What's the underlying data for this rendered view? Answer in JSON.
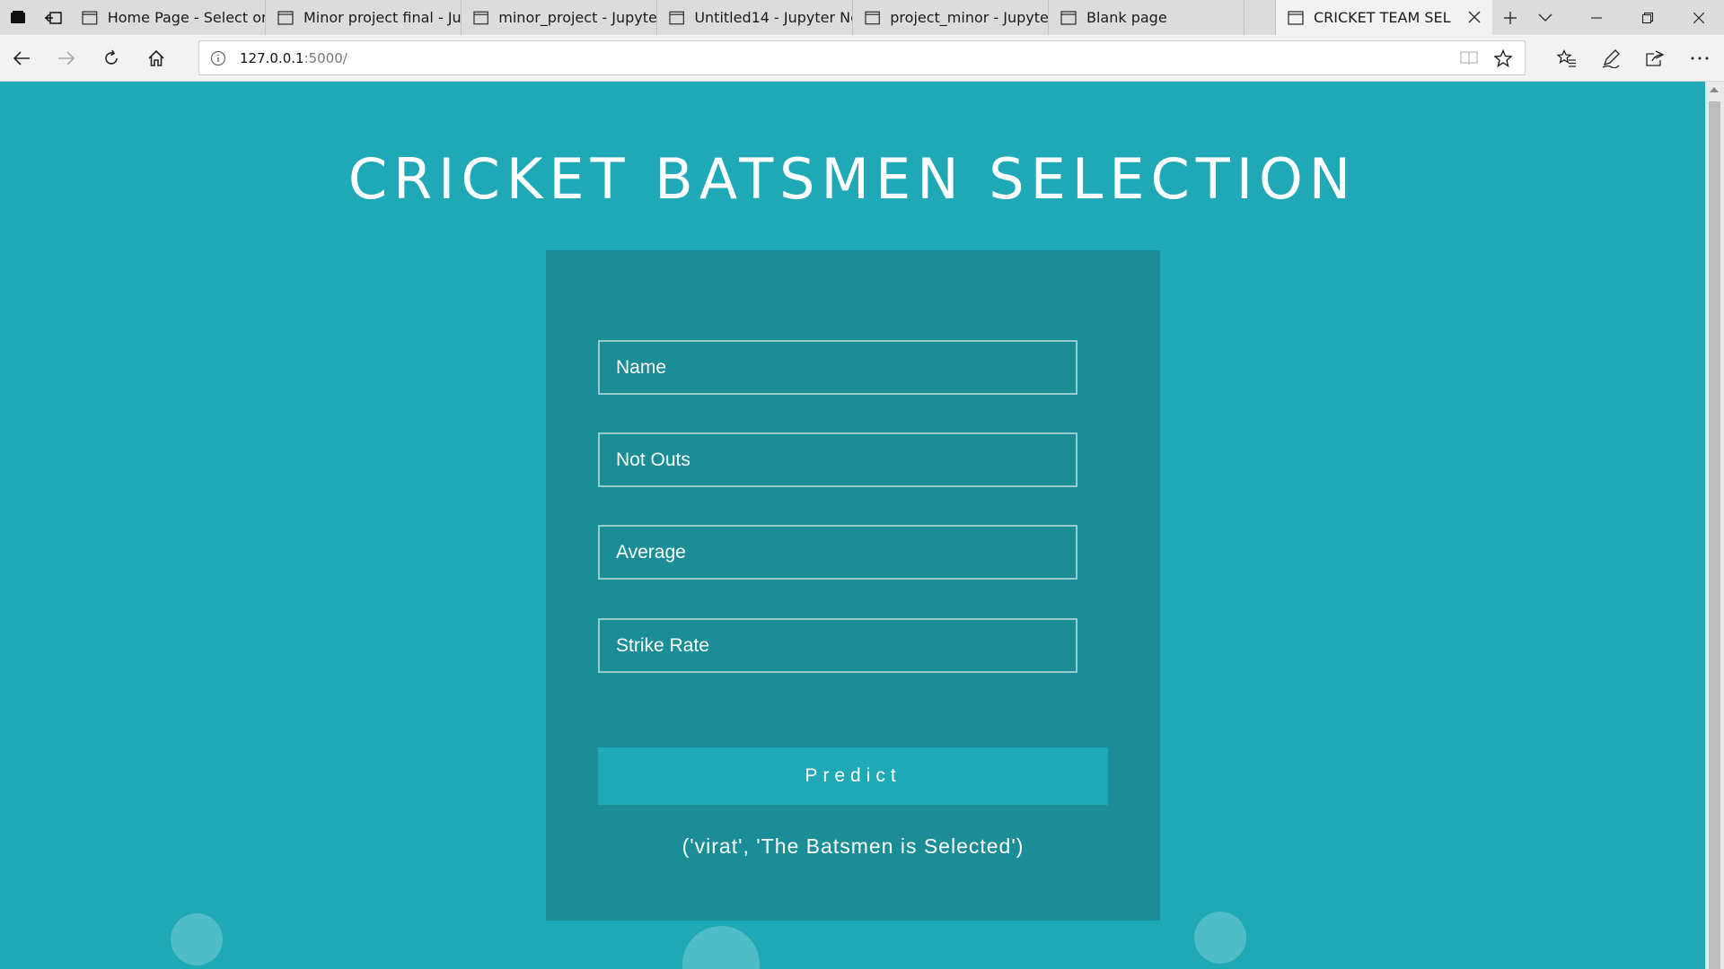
{
  "browser": {
    "tabs": [
      {
        "label": "Home Page - Select or"
      },
      {
        "label": "Minor project final - Ju"
      },
      {
        "label": "minor_project - Jupyter"
      },
      {
        "label": "Untitled14 - Jupyter Nc"
      },
      {
        "label": "project_minor - Jupyter"
      },
      {
        "label": "Blank page"
      }
    ],
    "active_tab": {
      "label": "CRICKET TEAM SEL"
    },
    "url_host": "127.0.0.1",
    "url_path": ":5000/"
  },
  "page": {
    "title": "CRICKET BATSMEN SELECTION",
    "form": {
      "name_placeholder": "Name",
      "not_outs_placeholder": "Not Outs",
      "average_placeholder": "Average",
      "strike_rate_placeholder": "Strike Rate",
      "predict_label": "Predict"
    },
    "result": "('virat', 'The Batsmen is Selected')"
  },
  "colors": {
    "background": "#1fa9b7",
    "card": "#1a8d97",
    "button": "#1fa9b7",
    "text": "#ffffff"
  }
}
